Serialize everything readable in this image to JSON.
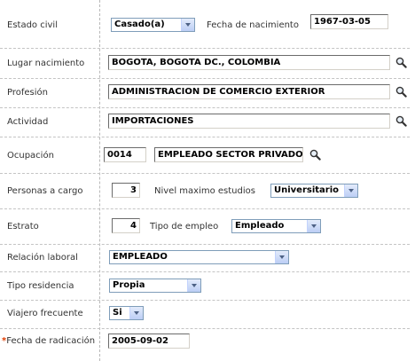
{
  "estado_civil": {
    "label": "Estado civil",
    "value": "Casado(a)"
  },
  "fecha_nacimiento": {
    "label": "Fecha de nacimiento",
    "value": "1967-03-05"
  },
  "lugar_nacimiento": {
    "label": "Lugar nacimiento",
    "value": "BOGOTA, BOGOTA DC., COLOMBIA",
    "icon": "magnifier-icon"
  },
  "profesion": {
    "label": "Profesión",
    "value": "ADMINISTRACION DE COMERCIO EXTERIOR",
    "icon": "magnifier-icon"
  },
  "actividad": {
    "label": "Actividad",
    "value": "IMPORTACIONES",
    "icon": "magnifier-icon"
  },
  "ocupacion": {
    "label": "Ocupación",
    "code": "0014",
    "value": "EMPLEADO SECTOR PRIVADO",
    "icon": "magnifier-icon"
  },
  "personas_cargo": {
    "label": "Personas a cargo",
    "value": "3"
  },
  "nivel_estudios": {
    "label": "Nivel maximo estudios",
    "value": "Universitario"
  },
  "estrato": {
    "label": "Estrato",
    "value": "4"
  },
  "tipo_empleo": {
    "label": "Tipo de empleo",
    "value": "Empleado"
  },
  "relacion_laboral": {
    "label": "Relación laboral",
    "value": "EMPLEADO"
  },
  "tipo_residencia": {
    "label": "Tipo residencia",
    "value": "Propia"
  },
  "viajero_frecuente": {
    "label": "Viajero frecuente",
    "value": "Si"
  },
  "fecha_radicacion": {
    "label": "Fecha de radicación",
    "required_marker": "*",
    "value": "2005-09-02"
  },
  "colors": {
    "required": "#e03c00",
    "select_border": "#7f9db9",
    "divider": "#c4c4c4"
  }
}
